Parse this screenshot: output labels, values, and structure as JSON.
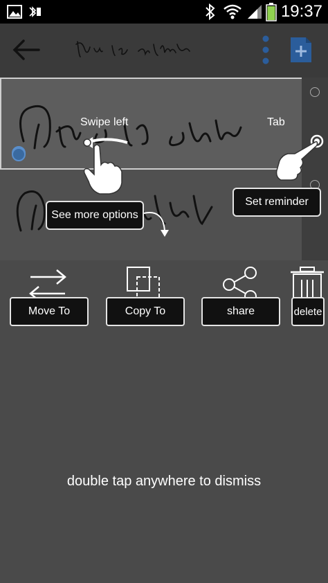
{
  "status_bar": {
    "time": "19:37",
    "icons": [
      "image-icon",
      "bluetooth-vibrate-icon",
      "bluetooth-icon",
      "wifi-icon",
      "signal-icon",
      "battery-icon"
    ]
  },
  "app_bar": {
    "back_icon": "arrow-left-icon",
    "more_icon": "overflow-menu-icon",
    "new_icon": "new-note-icon"
  },
  "tutorial": {
    "swipe_label": "Swipe left",
    "tab_label": "Tab",
    "see_more_label": "See more options",
    "reminder_label": "Set reminder"
  },
  "actions": [
    {
      "label": "Move To",
      "icon": "swap-arrows-icon"
    },
    {
      "label": "Copy To",
      "icon": "copy-icon"
    },
    {
      "label": "share",
      "icon": "share-icon"
    },
    {
      "label": "delete",
      "icon": "trash-icon"
    }
  ],
  "dismiss_text": "double tap anywhere to dismiss",
  "colors": {
    "overlay_bg": "#4a4a4a",
    "button_bg": "#111111",
    "accent_blue": "#3a6aa0",
    "new_note_blue": "#2b5d9b"
  }
}
